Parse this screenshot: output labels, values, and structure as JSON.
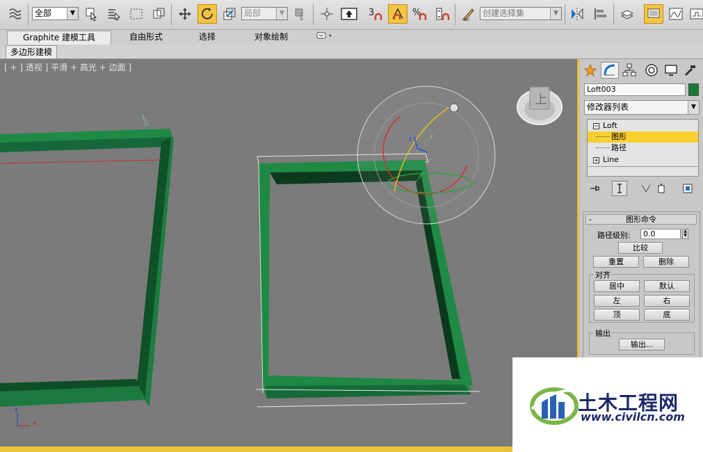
{
  "toolbar": {
    "selection_filter": "全部",
    "coord_system": "局部",
    "named_selection_placeholder": "创建选择集",
    "angle_snap_label": "3",
    "percent_snap_label": "%"
  },
  "ribbon": {
    "tabs": [
      "Graphite 建模工具",
      "自由形式",
      "选择",
      "对象绘制"
    ],
    "active_subtab": "多边形建模"
  },
  "viewport": {
    "label": "[ + ] 透视 ] 平滑 + 高光 + 边面 ]",
    "viewcube_face": "上",
    "axis_x": "x",
    "axis_y": "y",
    "axis_z": "z",
    "object_color": "#1e7a3c"
  },
  "command_panel": {
    "object_name": "Loft003",
    "object_color": "#1a7a3a",
    "modifier_list": "修改器列表",
    "stack": [
      {
        "label": "Loft",
        "expander": "⊟"
      },
      {
        "label": "图形",
        "selected": true
      },
      {
        "label": "路径"
      },
      {
        "label": "Line",
        "expander": "⊞"
      }
    ],
    "rollout": {
      "title": "图形命令",
      "collapse_sign": "-",
      "path_level_label": "路径级别:",
      "path_level_value": "0.0",
      "compare": "比较",
      "reset": "重置",
      "delete": "删除",
      "align_group": "对齐",
      "center": "居中",
      "default": "默认",
      "left": "左",
      "right": "右",
      "top": "顶",
      "bottom": "底",
      "output_group": "输出",
      "output_button": "输出..."
    }
  },
  "watermark": {
    "title": "土木工程网",
    "url": "www.civilcn.com"
  }
}
